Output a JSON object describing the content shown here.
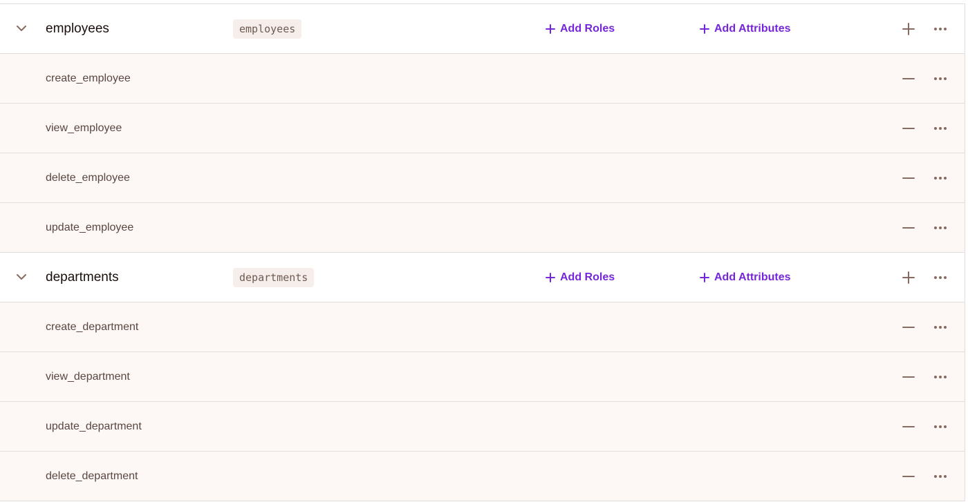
{
  "colors": {
    "accent": "#7626d9",
    "icon": "#8a6a60",
    "action_row_bg": "#fdf8f5",
    "border": "#e2dcda"
  },
  "resources": [
    {
      "name": "employees",
      "key": "employees",
      "add_roles_label": "Add Roles",
      "add_attributes_label": "Add Attributes",
      "actions": [
        {
          "name": "create_employee"
        },
        {
          "name": "view_employee"
        },
        {
          "name": "delete_employee"
        },
        {
          "name": "update_employee"
        }
      ]
    },
    {
      "name": "departments",
      "key": "departments",
      "add_roles_label": "Add Roles",
      "add_attributes_label": "Add Attributes",
      "actions": [
        {
          "name": "create_department"
        },
        {
          "name": "view_department"
        },
        {
          "name": "update_department"
        },
        {
          "name": "delete_department"
        }
      ]
    }
  ],
  "icons": {
    "expand": "chevron-down-icon",
    "add": "plus-icon",
    "remove": "minus-icon",
    "more": "more-horizontal-icon"
  }
}
